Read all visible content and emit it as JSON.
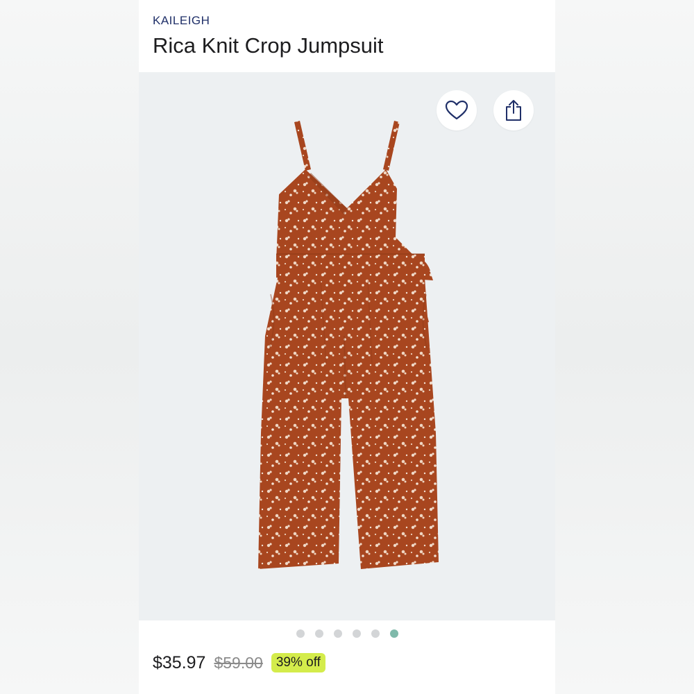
{
  "product": {
    "brand": "KAILEIGH",
    "name": "Rica Knit Crop Jumpsuit"
  },
  "actions": {
    "favorite_icon": "heart-icon",
    "share_icon": "share-icon"
  },
  "carousel": {
    "total": 6,
    "active_index": 5
  },
  "pricing": {
    "price": "$35.97",
    "original_price": "$59.00",
    "discount_badge": "39% off"
  },
  "colors": {
    "brand_text": "#1f2f68",
    "garment": "#a8461f",
    "badge_bg": "#d4ec4b",
    "active_dot": "#7fb9aa"
  }
}
